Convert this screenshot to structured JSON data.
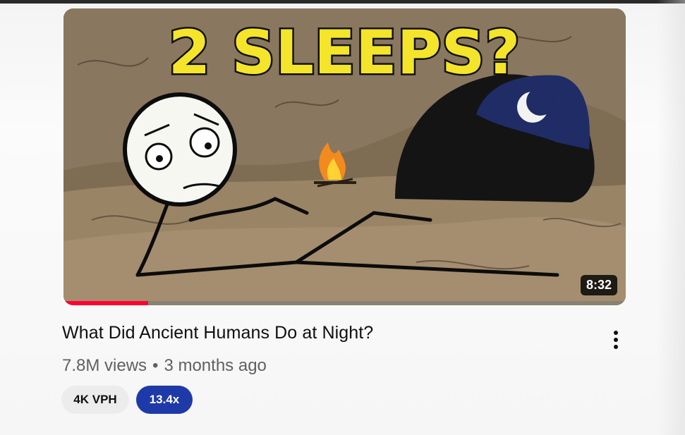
{
  "video": {
    "thumbnail_text": "2 SLEEPS?",
    "duration": "8:32",
    "watch_progress": 0.15,
    "title": "What Did Ancient Humans Do at Night?",
    "views": "7.8M views",
    "separator": "•",
    "age": "3 months ago"
  },
  "badges": {
    "vph": "4K VPH",
    "multiplier": "13.4x"
  },
  "colors": {
    "progress": "#ff0033",
    "multiplier_badge": "#1e3aa8",
    "thumbnail_text": "#f4e52b"
  },
  "icons": {
    "menu": "more-vertical-icon"
  }
}
